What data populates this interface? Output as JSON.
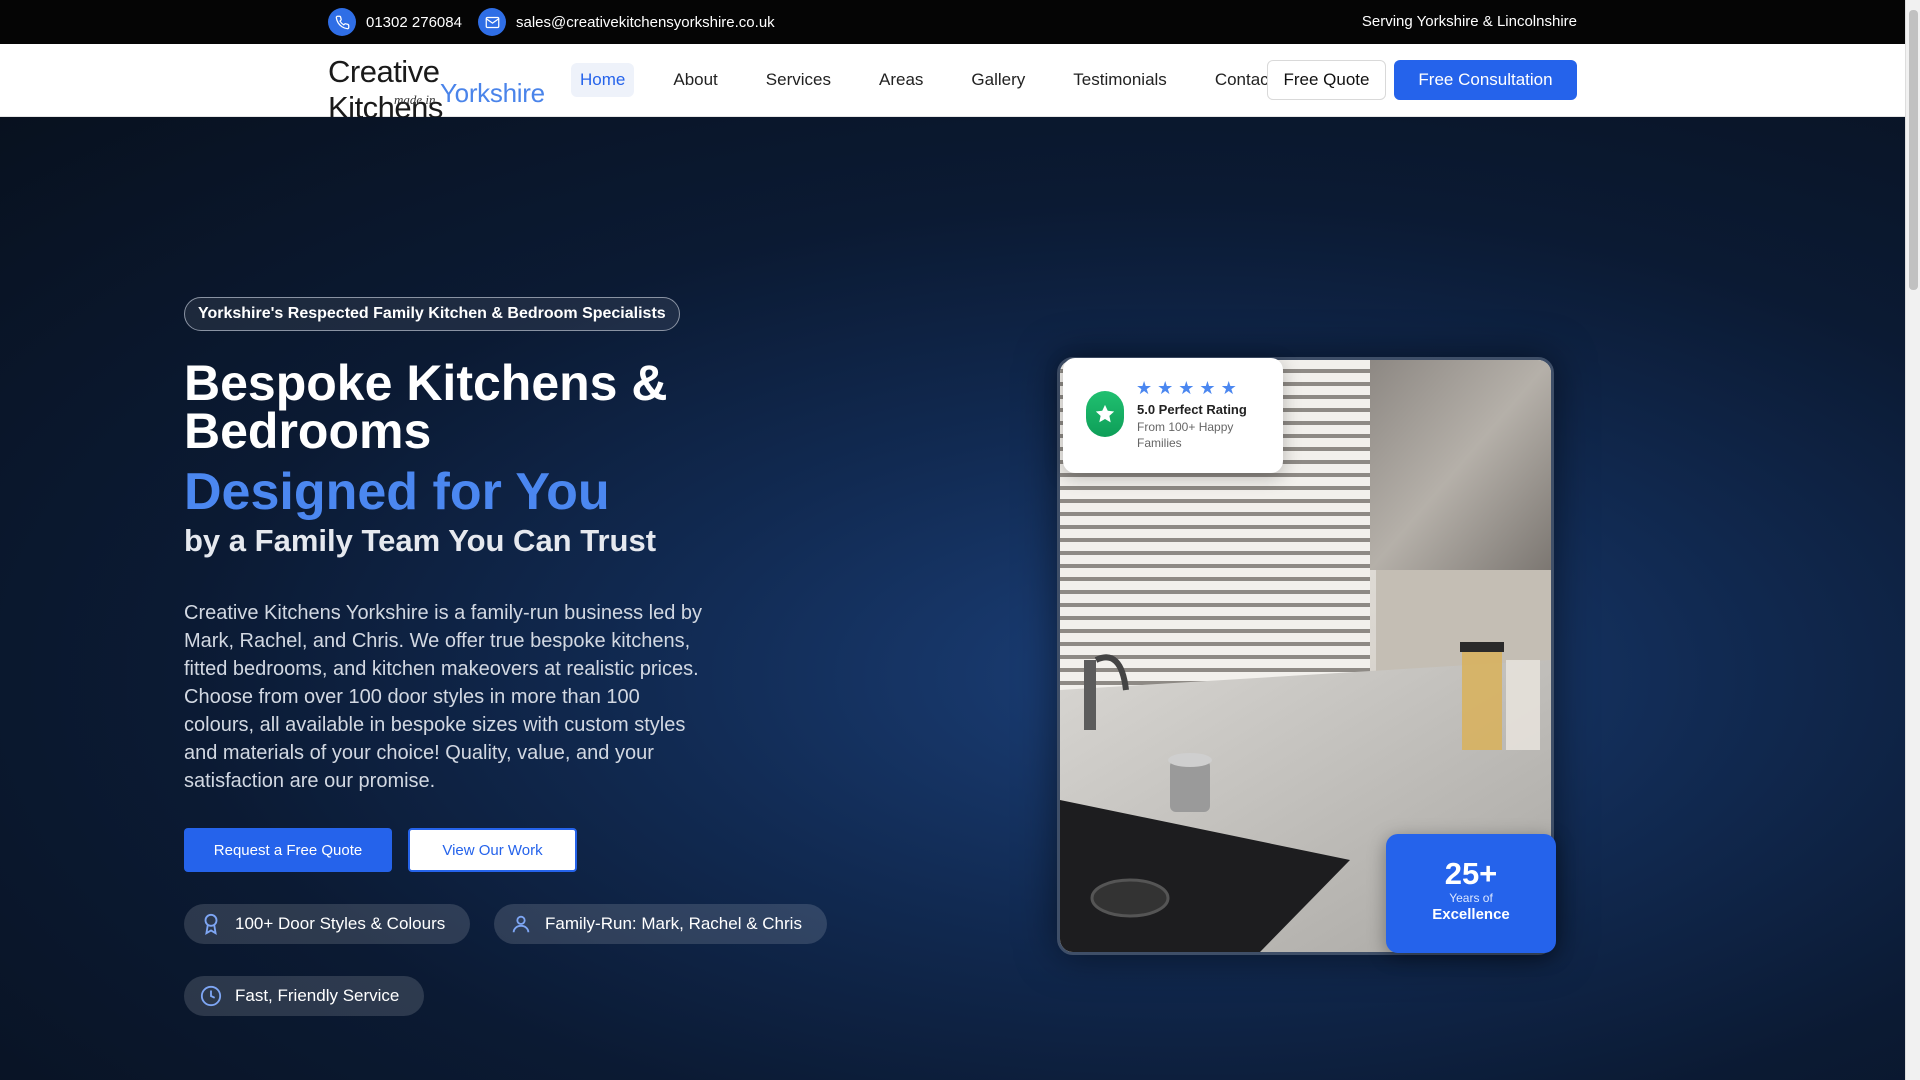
{
  "topbar": {
    "phone": "01302 276084",
    "email": "sales@creativekitchensyorkshire.co.uk",
    "serving": "Serving Yorkshire & Lincolnshire"
  },
  "logo": {
    "line1": "Creative Kitchens",
    "line2": "made in",
    "line3": "Yorkshire"
  },
  "nav": {
    "items": [
      {
        "label": "Home",
        "active": true
      },
      {
        "label": "About"
      },
      {
        "label": "Services"
      },
      {
        "label": "Areas"
      },
      {
        "label": "Gallery"
      },
      {
        "label": "Testimonials"
      },
      {
        "label": "Contact"
      }
    ],
    "free_quote": "Free Quote",
    "free_consultation": "Free Consultation"
  },
  "hero": {
    "pill": "Yorkshire's Respected Family Kitchen & Bedroom Specialists",
    "title": "Bespoke Kitchens & Bedrooms",
    "highlight": "Designed for You",
    "subtitle": "by a Family Team You Can Trust",
    "paragraph": "Creative Kitchens Yorkshire is a family-run business led by Mark, Rachel, and Chris. We offer true bespoke kitchens, fitted bedrooms, and kitchen makeovers at realistic prices. Choose from over 100 door styles in more than 100 colours, all available in bespoke sizes with custom styles and materials of your choice! Quality, value, and your satisfaction are our promise.",
    "cta_primary": "Request a Free Quote",
    "cta_secondary": "View Our Work",
    "features": [
      {
        "label": "100+ Door Styles & Colours",
        "icon": "award-icon"
      },
      {
        "label": "Family-Run: Mark, Rachel & Chris",
        "icon": "user-icon"
      },
      {
        "label": "Fast, Friendly Service",
        "icon": "clock-icon"
      }
    ]
  },
  "rating_card": {
    "stars": 5,
    "title": "5.0 Perfect Rating",
    "subtitle": "From 100+ Happy Families"
  },
  "years_card": {
    "number": "25+",
    "small": "Years of",
    "label": "Excellence"
  },
  "colors": {
    "accent": "#2563eb",
    "highlight": "#4b87f0",
    "badge_green": "#16a864"
  }
}
